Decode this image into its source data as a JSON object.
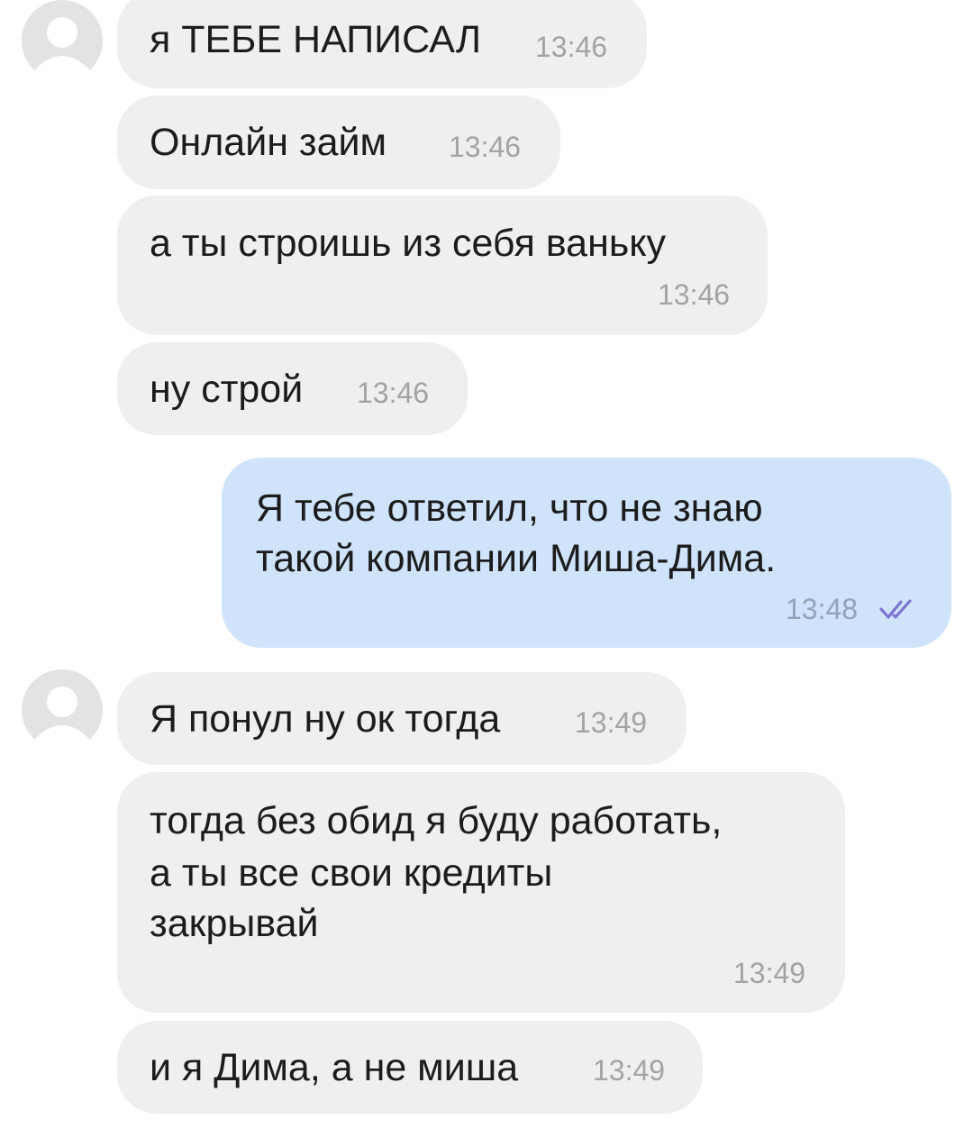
{
  "messages": [
    {
      "direction": "in",
      "avatar": true,
      "lines": [
        "я ТЕБЕ НАПИСАЛ"
      ],
      "time": "13:46"
    },
    {
      "direction": "in",
      "avatar": false,
      "lines": [
        "Онлайн займ"
      ],
      "time": "13:46"
    },
    {
      "direction": "in",
      "avatar": false,
      "lines": [
        "а ты строишь из себя ваньку"
      ],
      "time": "13:46"
    },
    {
      "direction": "in",
      "avatar": false,
      "lines": [
        "ну строй"
      ],
      "time": "13:46"
    },
    {
      "direction": "out",
      "avatar": false,
      "lines": [
        "Я тебе ответил, что не знаю",
        "такой компании Миша-Дима."
      ],
      "time": "13:48",
      "status_icon": "double-check-icon"
    },
    {
      "direction": "in",
      "avatar": true,
      "lines": [
        "Я понул ну ок тогда"
      ],
      "time": "13:49"
    },
    {
      "direction": "in",
      "avatar": false,
      "lines": [
        "тогда без обид я буду работать,",
        "а ты все свои кредиты",
        "закрывай"
      ],
      "time": "13:49"
    },
    {
      "direction": "in",
      "avatar": false,
      "lines": [
        "и я Дима, а не миша"
      ],
      "time": "13:49"
    }
  ],
  "colors": {
    "incoming_bubble": "#efefef",
    "outgoing_bubble": "#cfe3fb",
    "text": "#1c1c1c",
    "time": "#a3a3a3",
    "read_check": "#7b6fd0",
    "avatar_bg": "#e3e3e3",
    "avatar_fg": "#ffffff"
  }
}
